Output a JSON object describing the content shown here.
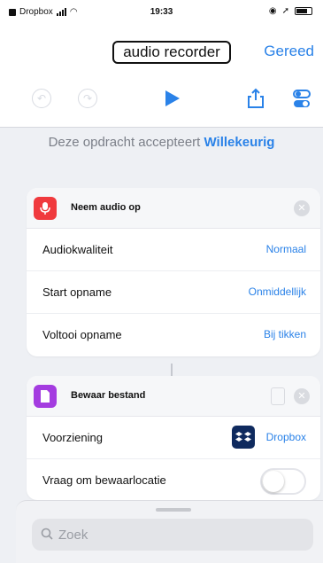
{
  "status_bar": {
    "carrier": "Dropbox",
    "time": "19:33"
  },
  "nav": {
    "title": "audio recorder",
    "done_label": "Gereed"
  },
  "accepts": {
    "prefix": "Deze opdracht accepteert",
    "value": "Willekeurig"
  },
  "record_action": {
    "title": "Neem audio op",
    "rows": [
      {
        "label": "Audiokwaliteit",
        "value": "Normaal"
      },
      {
        "label": "Start opname",
        "value": "Onmiddellijk"
      },
      {
        "label": "Voltooi opname",
        "value": "Bij tikken"
      }
    ]
  },
  "save_action": {
    "title": "Bewaar bestand",
    "service_label": "Voorziening",
    "service_value": "Dropbox",
    "ask_label": "Vraag om bewaarlocatie",
    "ask_toggle_on": false
  },
  "search": {
    "placeholder": "Zoek"
  },
  "colors": {
    "accent": "#2a82e8",
    "record_red": "#f03a3e",
    "files_purple": "#a43ce0",
    "dropbox_navy": "#0f2a5e"
  },
  "icons": [
    "undo-icon",
    "redo-icon",
    "play-icon",
    "share-icon",
    "settings-icon",
    "microphone-icon",
    "document-icon",
    "dropbox-icon",
    "close-icon",
    "search-icon"
  ]
}
